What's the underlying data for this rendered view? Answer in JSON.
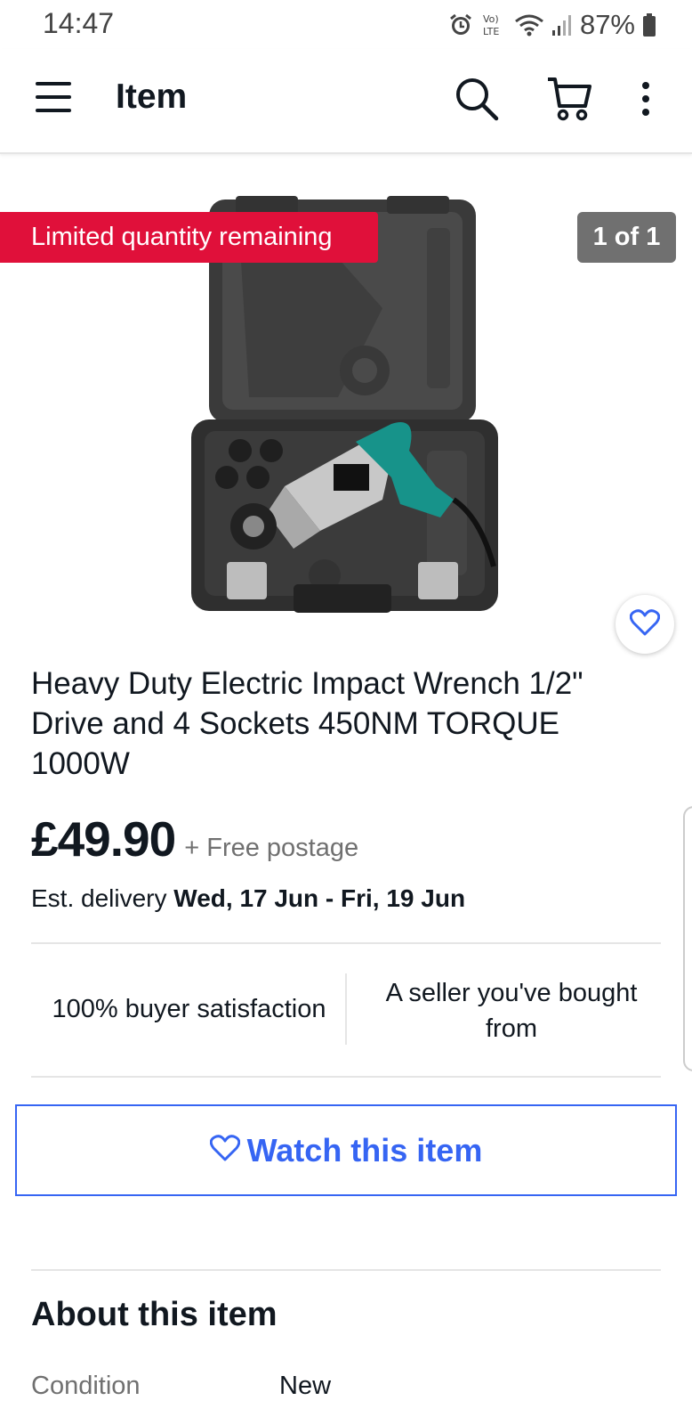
{
  "status_bar": {
    "time": "14:47",
    "network": "LTE",
    "battery": "87%"
  },
  "app_bar": {
    "title": "Item"
  },
  "gallery": {
    "badge": "Limited quantity remaining",
    "counter": "1 of 1"
  },
  "item": {
    "title": "Heavy Duty Electric Impact Wrench 1/2\" Drive and 4 Sockets 450NM TORQUE 1000W",
    "price": "£49.90",
    "postage": "+ Free postage",
    "delivery_prefix": "Est. delivery",
    "delivery_dates": "Wed, 17 Jun - Fri, 19 Jun"
  },
  "seller": {
    "satisfaction": "100% buyer satisfaction",
    "relationship": "A seller you've bought from"
  },
  "watch_button": {
    "label": "Watch this item"
  },
  "about": {
    "heading": "About this item",
    "condition_label": "Condition",
    "condition_value": "New"
  },
  "colors": {
    "accent": "#3665f3",
    "badge": "#e0103a",
    "counter_bg": "#707070",
    "text": "#111820",
    "muted": "#707070"
  }
}
